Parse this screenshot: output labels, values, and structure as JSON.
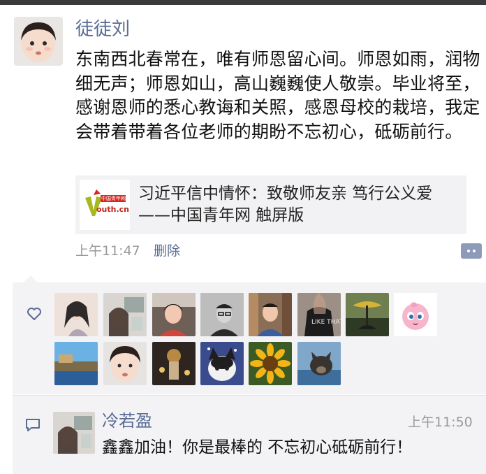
{
  "post": {
    "author": "徒徒刘",
    "text": "东南西北春常在，唯有师恩留心间。师恩如雨，润物细无声；师恩如山，高山巍巍使人敬崇。毕业将至，感谢恩师的悉心教诲和关照，感恩母校的栽培，我定会带着带着各位老师的期盼不忘初心，砥砺前行。",
    "link": {
      "title": "习近平信中情怀：致敬师友亲 笃行公义爱——中国青年网 触屏版",
      "thumb_brand_top": "中国青年网",
      "thumb_brand_bottom": "outh.cn"
    },
    "time": "上午11:47",
    "delete_label": "删除"
  },
  "likes": {
    "icon": "heart-icon",
    "avatars": [
      "anime-girl-avatar",
      "child-photo-avatar",
      "woman-smiling-avatar",
      "man-glasses-bw-avatar",
      "man-bookshelf-avatar",
      "like-that-shirt-avatar",
      "tree-sunset-avatar",
      "jigglypuff-avatar",
      "coastline-avatar",
      "girl-face-avatar",
      "night-scene-avatar",
      "cat-avatar",
      "sunflower-avatar",
      "dog-avatar"
    ],
    "shirt_text": "LIKE THAT"
  },
  "comment": {
    "icon": "comment-icon",
    "name": "冷若盈",
    "time": "上午11:50",
    "text": "鑫鑫加油！你是最棒的 不忘初心砥砺前行！"
  },
  "colors": {
    "name_link": "#586b95",
    "meta_gray": "#9a9a9a",
    "panel_bg": "#f3f3f5",
    "more_btn": "#8d9bb9"
  }
}
